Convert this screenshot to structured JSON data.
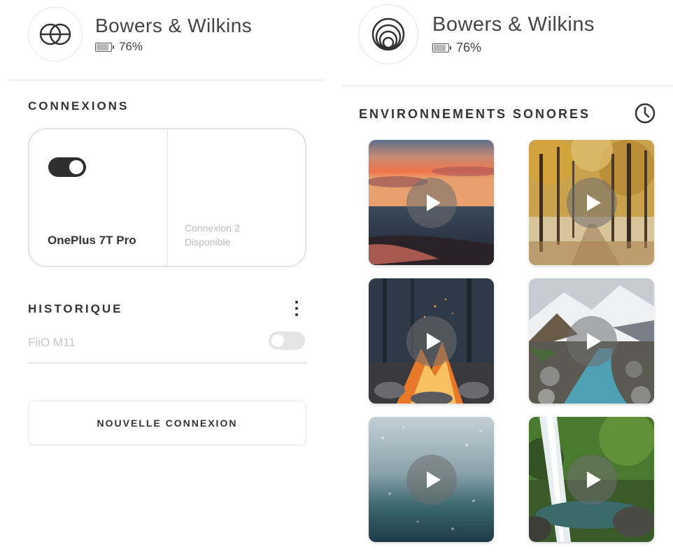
{
  "left_panel": {
    "brand": "Bowers & Wilkins",
    "battery_label": "76%",
    "battery_level": 0.76,
    "logo_icon": "interlocking-rings-icon",
    "connections": {
      "title": "CONNEXIONS",
      "slot1": {
        "device_name": "OnePlus 7T Pro",
        "toggle_on": true
      },
      "slot2": {
        "label": "Connexion 2",
        "status": "Disponible"
      }
    },
    "history": {
      "title": "HISTORIQUE",
      "menu_icon": "more-vertical-icon",
      "items": [
        {
          "name": "FiiO M11",
          "toggle_on": false
        }
      ]
    },
    "new_connection_label": "NOUVELLE CONNEXION"
  },
  "right_panel": {
    "brand": "Bowers & Wilkins",
    "battery_label": "76%",
    "battery_level": 0.76,
    "logo_icon": "concentric-rings-icon",
    "soundscapes": {
      "title": "ENVIRONNEMENTS SONORES",
      "history_icon": "clock-icon",
      "tiles": [
        {
          "scene": "sunset-sea",
          "icon": "play-icon"
        },
        {
          "scene": "autumn-forest",
          "icon": "play-icon"
        },
        {
          "scene": "campfire",
          "icon": "play-icon"
        },
        {
          "scene": "mountain-river",
          "icon": "play-icon"
        },
        {
          "scene": "rain-window",
          "icon": "play-icon"
        },
        {
          "scene": "waterfall",
          "icon": "play-icon"
        }
      ]
    }
  },
  "colors": {
    "text": "#333333",
    "muted": "#bcbcbc",
    "border": "#e2e2e2",
    "toggle_on": "#2f2f2f",
    "toggle_off": "#e4e4e4"
  }
}
